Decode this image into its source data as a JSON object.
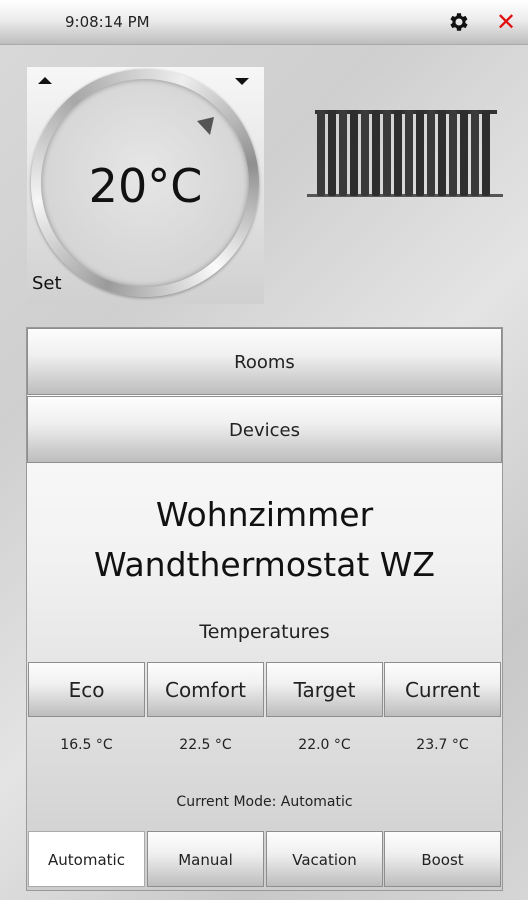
{
  "header": {
    "time": "9:08:14 PM"
  },
  "thermostat": {
    "temperature": "20°C",
    "set_label": "Set"
  },
  "nav": {
    "rooms_label": "Rooms",
    "devices_label": "Devices"
  },
  "device": {
    "room": "Wohnzimmer",
    "name": "Wandthermostat WZ"
  },
  "temperatures": {
    "title": "Temperatures",
    "headers": [
      "Eco",
      "Comfort",
      "Target",
      "Current"
    ],
    "values": [
      "16.5 °C",
      "22.5 °C",
      "22.0 °C",
      "23.7 °C"
    ]
  },
  "mode": {
    "status": "Current Mode: Automatic",
    "options": [
      "Automatic",
      "Manual",
      "Vacation",
      "Boost"
    ],
    "selected": "Automatic"
  },
  "colors": {
    "close_icon": "#e01010",
    "accent_gray": "#bdbdbd"
  },
  "icons": {
    "settings": "gear-icon",
    "close": "close-icon",
    "radiator": "radiator-icon"
  }
}
